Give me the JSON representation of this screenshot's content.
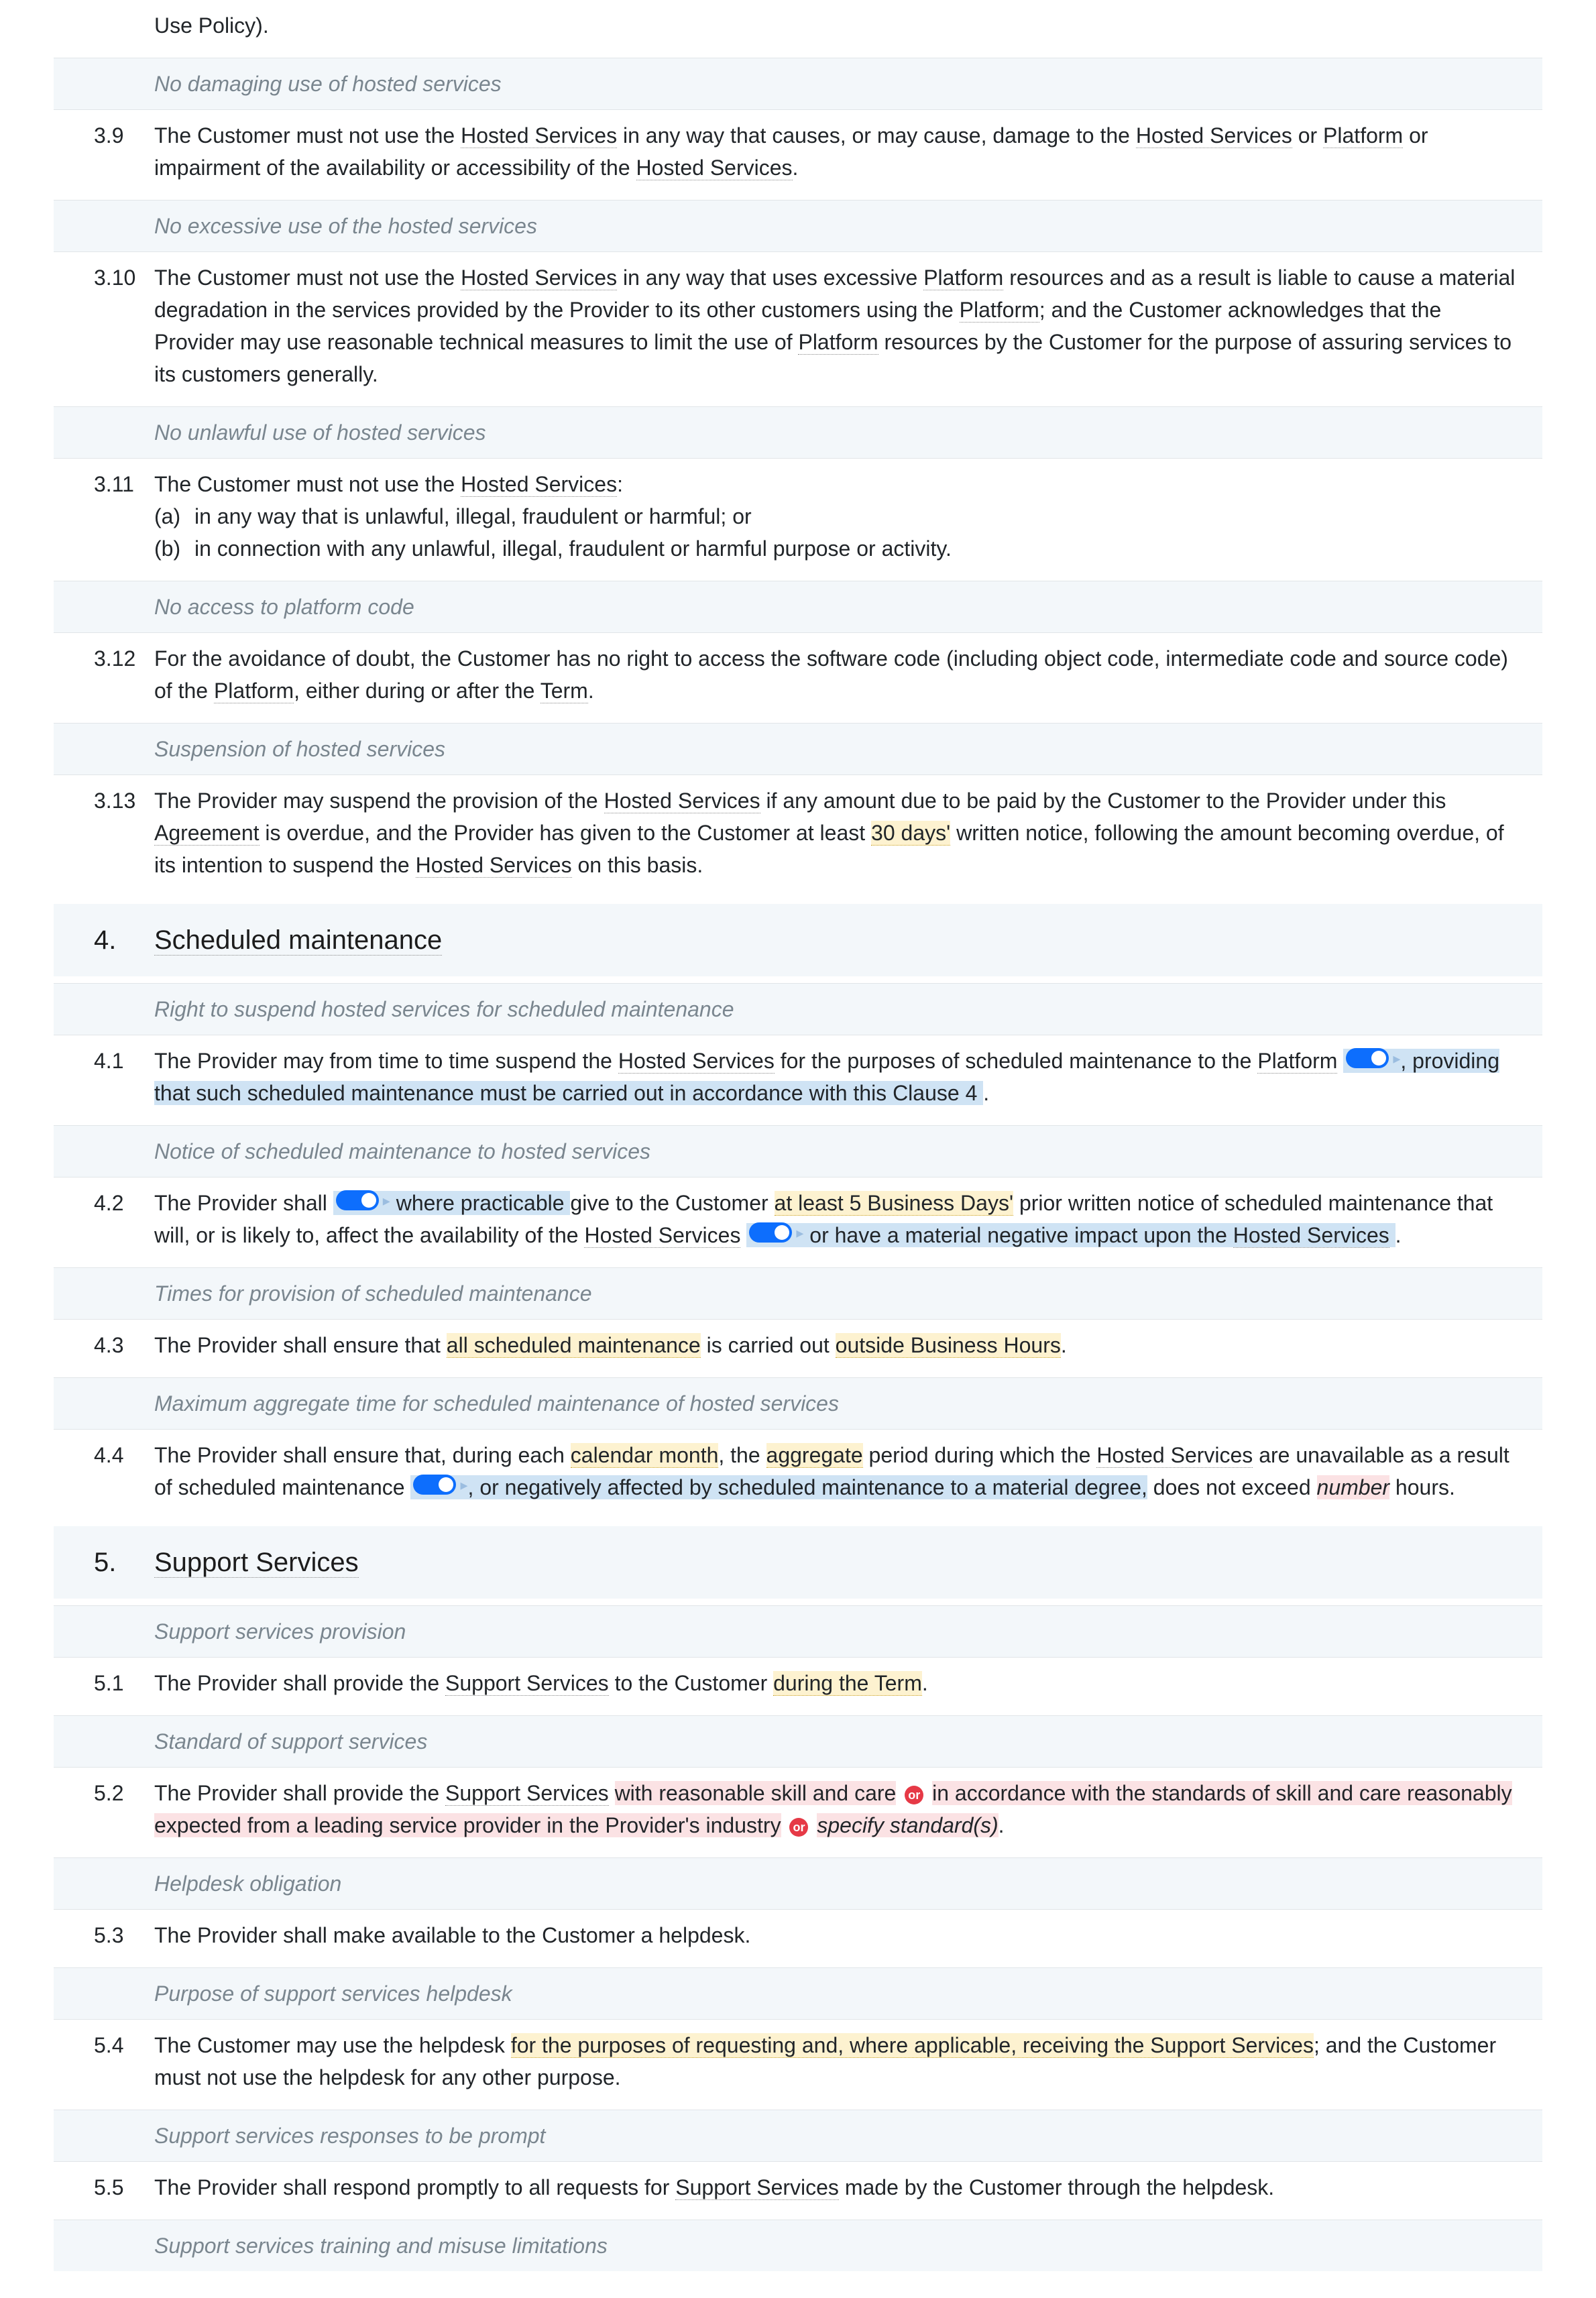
{
  "intro": {
    "fragment_pre": "Use Policy)."
  },
  "captions": {
    "c0": "No damaging use of hosted services",
    "c1": "No excessive use of the hosted services",
    "c2": "No unlawful use of hosted services",
    "c3": "No access to platform code",
    "c4": "Suspension of hosted services",
    "c5": "Right to suspend hosted services for scheduled maintenance",
    "c6": "Notice of scheduled maintenance to hosted services",
    "c7": "Times for provision of scheduled maintenance",
    "c8": "Maximum aggregate time for scheduled maintenance of hosted services",
    "c9": "Support services provision",
    "c10": "Standard of support services",
    "c11": "Helpdesk obligation",
    "c12": "Purpose of support services helpdesk",
    "c13": "Support services responses to be prompt",
    "c14": "Support services training and misuse limitations"
  },
  "cl39": {
    "num": "3.9",
    "t1": "The Customer must not use the ",
    "hs": "Hosted Services",
    "t2": " in any way that causes, or may cause, damage to the ",
    "t3": " or ",
    "pf": "Platform",
    "t4": " or impairment of the availability or accessibility of the ",
    "t5": "."
  },
  "cl310": {
    "num": "3.10",
    "t1": "The Customer must not use the ",
    "hs": "Hosted Services",
    "t2": " in any way that uses excessive ",
    "pf": "Platform",
    "t3": " resources and as a result is liable to cause a material degradation in the services provided by the Provider to its other customers using the ",
    "t4": "; and the Customer acknowledges that the Provider may use reasonable technical measures to limit the use of ",
    "t5": " resources by the Customer for the purpose of assuring services to its customers generally."
  },
  "cl311": {
    "num": "3.11",
    "lead1": "The Customer must not use the ",
    "hs": "Hosted Services",
    "lead2": ":",
    "a_label": "(a)",
    "a_text": "in any way that is unlawful, illegal, fraudulent or harmful; or",
    "b_label": "(b)",
    "b_text": "in connection with any unlawful, illegal, fraudulent or harmful purpose or activity."
  },
  "cl312": {
    "num": "3.12",
    "t1": "For the avoidance of doubt, the Customer has no right to access the software code (including object code, intermediate code and source code) of the ",
    "pf": "Platform",
    "t2": ", either during or after the ",
    "term": "Term",
    "t3": "."
  },
  "cl313": {
    "num": "3.13",
    "t1": "The Provider may suspend the provision of the ",
    "hs": "Hosted Services",
    "t2": " if any amount due to be paid by the Customer to the Provider under this ",
    "ag": "Agreement",
    "t3": " is overdue, and the Provider has given to the Customer at least ",
    "days": "30 days'",
    "t4": " written notice, following the amount becoming overdue, of its intention to suspend the ",
    "t5": " on this basis."
  },
  "sec4": {
    "num": "4.",
    "title": "Scheduled maintenance"
  },
  "cl41": {
    "num": "4.1",
    "t1": "The Provider may from time to time suspend the ",
    "hs": "Hosted Services",
    "t2": " for the purposes of scheduled maintenance to the ",
    "pf": "Platform",
    "blue": ", providing that such scheduled maintenance must be carried out in accordance with this Clause 4",
    "t3": "."
  },
  "cl42": {
    "num": "4.2",
    "t1": "The Provider shall ",
    "blue1": "where practicable ",
    "t2": "give to the Customer ",
    "days": "at least 5 Business Days'",
    "t3": " prior written notice of scheduled maintenance that will, or is likely to, affect the availability of the ",
    "hs": "Hosted Services",
    "blue2a": "or have a material negative impact upon the ",
    "blue2b": "Hosted Services",
    "t4": "."
  },
  "cl43": {
    "num": "4.3",
    "t1": "The Provider shall ensure that ",
    "mid": "all scheduled maintenance",
    "t2": " is carried out ",
    "hrs": "outside Business Hours",
    "t3": "."
  },
  "cl44": {
    "num": "4.4",
    "t1": "The Provider shall ensure that, during each ",
    "mon": "calendar month",
    "t2": ", the ",
    "agg": "aggregate",
    "t3": " period during which the ",
    "hs": "Hosted Services",
    "t4": " are unavailable as a result of scheduled maintenance ",
    "blue": ", or negatively affected by scheduled maintenance to a material degree,",
    "t5": " does not exceed ",
    "placeholder": "number",
    "t6": " hours."
  },
  "sec5": {
    "num": "5.",
    "title": "Support Services"
  },
  "cl51": {
    "num": "5.1",
    "t1": "The Provider shall provide the ",
    "ss": "Support Services",
    "t2": " to the Customer ",
    "dur": "during the Term",
    "t3": "."
  },
  "cl52": {
    "num": "5.2",
    "t1": "The Provider shall provide the ",
    "ss": "Support Services",
    "pink1": "with reasonable skill and care",
    "or": "or",
    "pink2": "in accordance with the standards of skill and care reasonably expected from a leading service provider in the Provider's industry",
    "placeholder": "specify standard(s)",
    "t2": "."
  },
  "cl53": {
    "num": "5.3",
    "t1": "The Provider shall make available to the Customer a helpdesk."
  },
  "cl54": {
    "num": "5.4",
    "t1": "The Customer may use the helpdesk ",
    "mid": "for the purposes of requesting and, where applicable, receiving the Support Services",
    "t2": "; and the Customer must not use the helpdesk for any other purpose."
  },
  "cl55": {
    "num": "5.5",
    "t1": "The Provider shall respond promptly to all requests for ",
    "ss": "Support Services",
    "t2": " made by the Customer through the helpdesk."
  }
}
